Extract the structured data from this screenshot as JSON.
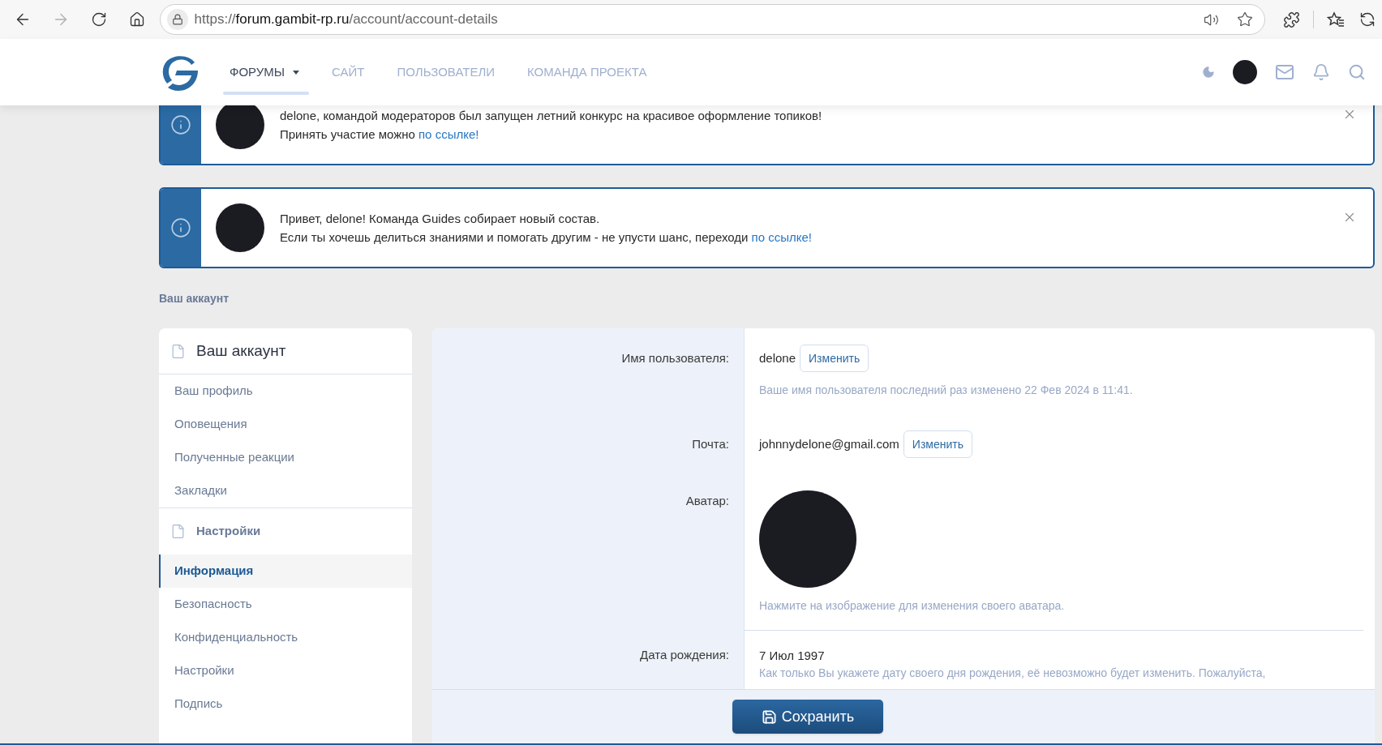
{
  "browser": {
    "url": {
      "scheme": "https://",
      "host": "forum.gambit-rp.ru",
      "path": "/account/account-details"
    }
  },
  "nav": {
    "items": [
      {
        "label": "ФОРУМЫ",
        "selected": true,
        "dropdown": true
      },
      {
        "label": "САЙТ",
        "selected": false,
        "dropdown": false
      },
      {
        "label": "ПОЛЬЗОВАТЕЛИ",
        "selected": false,
        "dropdown": false
      },
      {
        "label": "КОМАНДА ПРОЕКТА",
        "selected": false,
        "dropdown": false
      }
    ]
  },
  "notices": [
    {
      "line1": "delone, командой модераторов был запущен летний конкурс на красивое оформление топиков!",
      "line2": "Принять участие можно ",
      "link": "по ссылке!"
    },
    {
      "line1": "Привет, delone! Команда Guides собирает новый состав.",
      "line2": "Если ты хочешь делиться знаниями и помогать другим - не упусти шанс, переходи ",
      "link": "по ссылке!"
    }
  ],
  "breadcrumb": "Ваш аккаунт",
  "sidebar": {
    "sections": [
      {
        "title": "Ваш аккаунт",
        "kind": "heading",
        "items": [
          {
            "label": "Ваш профиль",
            "selected": false
          },
          {
            "label": "Оповещения",
            "selected": false
          },
          {
            "label": "Полученные реакции",
            "selected": false
          },
          {
            "label": "Закладки",
            "selected": false
          }
        ]
      },
      {
        "title": "Настройки",
        "kind": "group",
        "items": [
          {
            "label": "Информация",
            "selected": true
          },
          {
            "label": "Безопасность",
            "selected": false
          },
          {
            "label": "Конфиденциальность",
            "selected": false
          },
          {
            "label": "Настройки",
            "selected": false
          },
          {
            "label": "Подпись",
            "selected": false
          }
        ]
      }
    ]
  },
  "form": {
    "rows": [
      {
        "kind": "text",
        "label": "Имя пользователя:",
        "value": "delone",
        "button": "Изменить",
        "hint": "Ваше имя пользователя последний раз изменено 22 Фев 2024 в 11:41.",
        "separated": false
      },
      {
        "kind": "text",
        "label": "Почта:",
        "value": "johnnydelone@gmail.com",
        "button": "Изменить",
        "separated": false
      },
      {
        "kind": "avatar",
        "label": "Аватар:",
        "hint": "Нажмите на изображение для изменения своего аватара.",
        "separated": false
      },
      {
        "kind": "date",
        "label": "Дата рождения:",
        "value": "7 Июл 1997",
        "hint": "Как только Вы укажете дату своего дня рождения, её невозможно будет изменить. Пожалуйста,",
        "separated": true
      }
    ]
  },
  "save_button": "Сохранить"
}
